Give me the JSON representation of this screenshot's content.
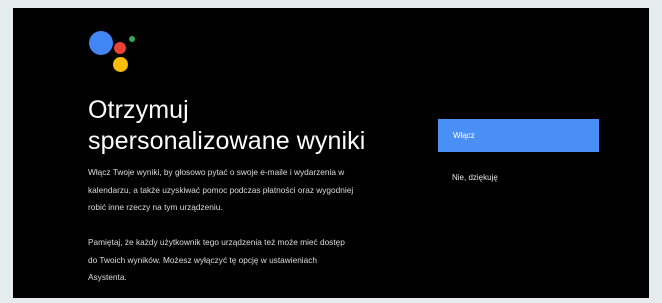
{
  "title_line1": "Otrzymuj",
  "title_line2": "spersonalizowane wyniki",
  "paragraph1_line1": "Włącz Twoje wyniki, by głosowo pytać o swoje e-maile i wydarzenia w",
  "paragraph1_line2": "kalendarzu, a także uzyskiwać pomoc podczas płatności oraz wygodniej",
  "paragraph1_line3": "robić inne rzeczy na tym urządzeniu.",
  "paragraph2_line1": "Pamiętaj, że każdy użytkownik tego urządzenia też może mieć dostęp",
  "paragraph2_line2": "do Twoich wyników. Możesz wyłączyć tę opcję w ustawieniach",
  "paragraph2_line3": "Asystenta.",
  "buttons": {
    "enable_label": "Włącz",
    "decline_label": "Nie, dziękuję"
  },
  "colors": {
    "background": "#000000",
    "accent": "#4a8ff5",
    "logo_blue": "#4285f4",
    "logo_red": "#ea4335",
    "logo_yellow": "#fbbc05",
    "logo_green": "#34a853"
  },
  "icons": [
    "google-assistant-logo-icon"
  ]
}
